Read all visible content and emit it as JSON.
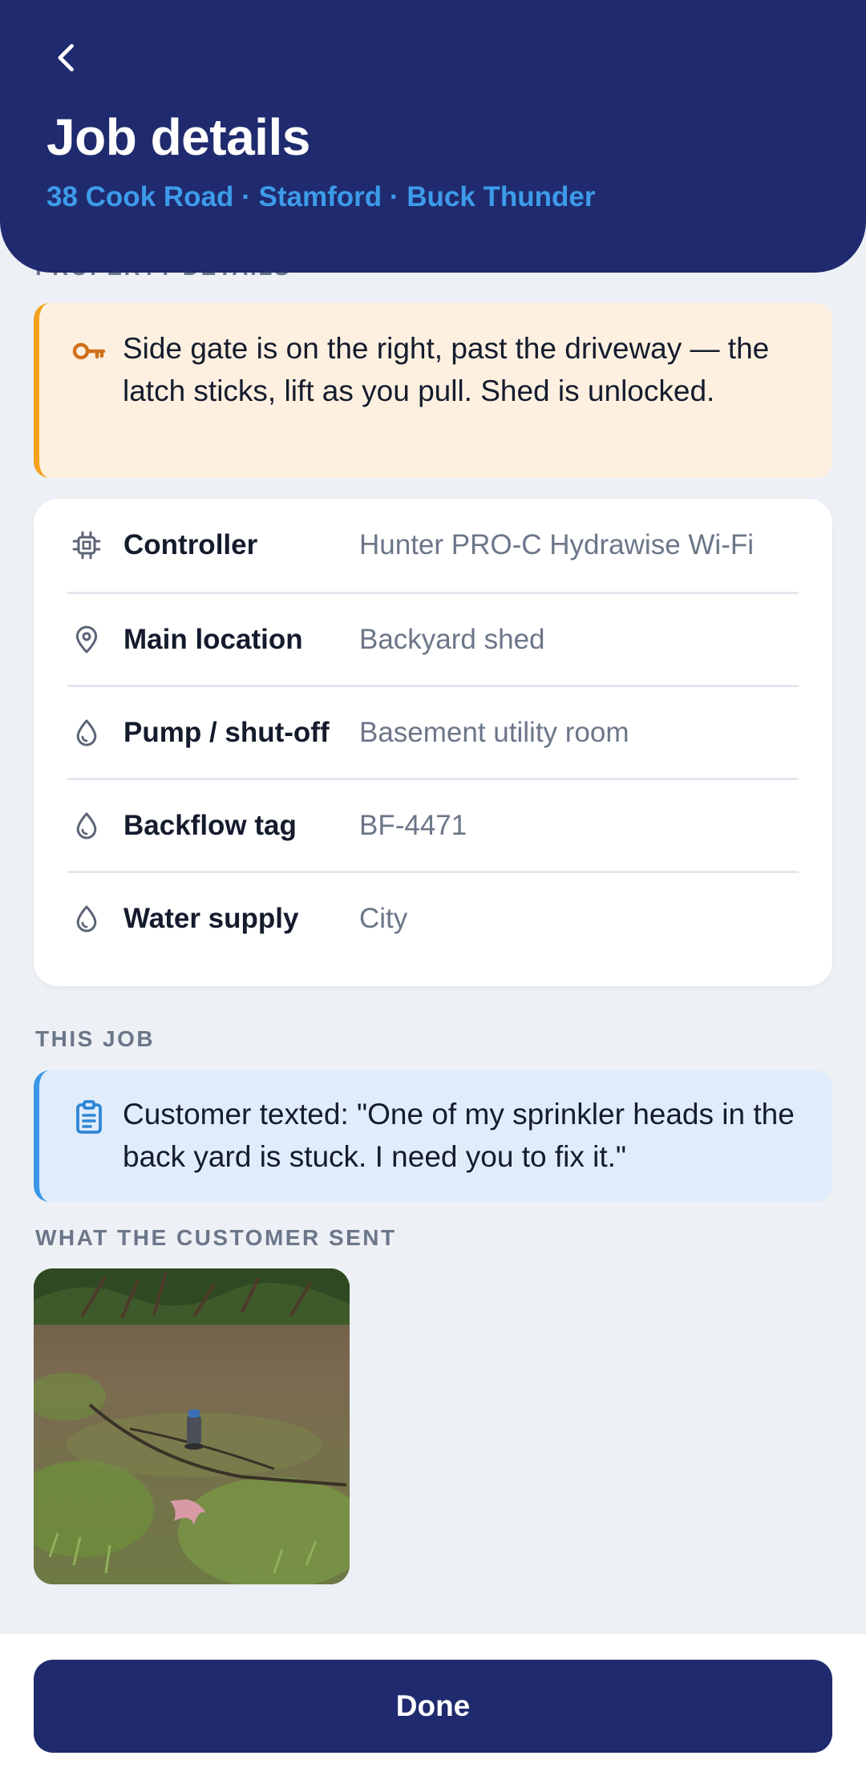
{
  "header": {
    "title": "Job details",
    "subtitle": "38 Cook Road · Stamford · Buck Thunder",
    "back_icon": "chevron-left-icon"
  },
  "property": {
    "section_label": "PROPERTY DETAILS",
    "access_note": "Side gate is on the right, past the driveway — the latch sticks, lift as you pull. Shed is unlocked.",
    "access_icon": "key-icon",
    "rows": [
      {
        "label": "Controller",
        "value": "Hunter PRO-C Hydrawise Wi-Fi",
        "icon": "chip-icon"
      },
      {
        "label": "Main location",
        "value": "Backyard shed",
        "icon": "map-pin-icon"
      },
      {
        "label": "Pump / shut-off",
        "value": "Basement utility room",
        "icon": "water-drop-icon"
      },
      {
        "label": "Backflow tag",
        "value": "BF-4471",
        "icon": "water-drop-icon"
      },
      {
        "label": "Water supply",
        "value": "City",
        "icon": "water-drop-icon"
      }
    ]
  },
  "job": {
    "section_label": "THIS JOB",
    "note": "Customer texted: \"One of my sprinkler heads in the back yard is stuck. I need you to fix it.\"",
    "note_icon": "clipboard-icon"
  },
  "attachments": {
    "section_label": "WHAT THE CUSTOMER SENT",
    "photo_subject": "sprinkler head in lawn"
  },
  "footer": {
    "done_label": "Done"
  },
  "colors": {
    "header_bg": "#1f2b6e",
    "accent_blue": "#3d9bea",
    "amber": "#f4a11d",
    "page_bg": "#edf0f5"
  }
}
